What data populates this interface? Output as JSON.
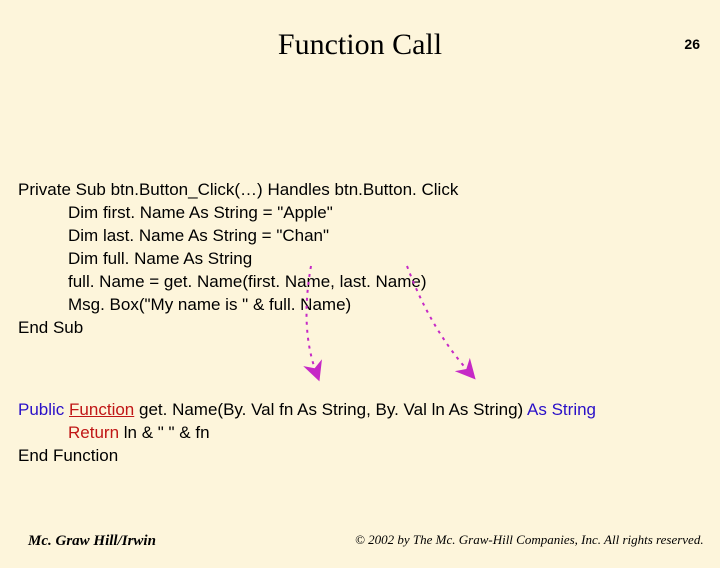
{
  "pageNumber": "26",
  "title": "Function Call",
  "sub": {
    "l1": "Private Sub btn.Button_Click(…) Handles btn.Button. Click",
    "l2": "Dim first. Name As String = \"Apple\"",
    "l3": "Dim last. Name As String = \"Chan\"",
    "l4": "Dim full. Name As String",
    "l5": "full. Name = get. Name(first. Name, last. Name)",
    "l6": "Msg. Box(\"My name is \" & full. Name)",
    "l7": "End Sub"
  },
  "func": {
    "kw_public": "Public",
    "kw_function": "Function",
    "name": "get. Name",
    "params": "(By. Val fn As String, By. Val ln As String)",
    "kw_as_string": "As String",
    "kw_return": "Return",
    "return_expr": " ln & \" \" & fn",
    "end": "End Function"
  },
  "footer": {
    "left": "Mc. Graw Hill/Irwin",
    "right": "© 2002 by The Mc. Graw-Hill Companies, Inc. All rights reserved."
  }
}
